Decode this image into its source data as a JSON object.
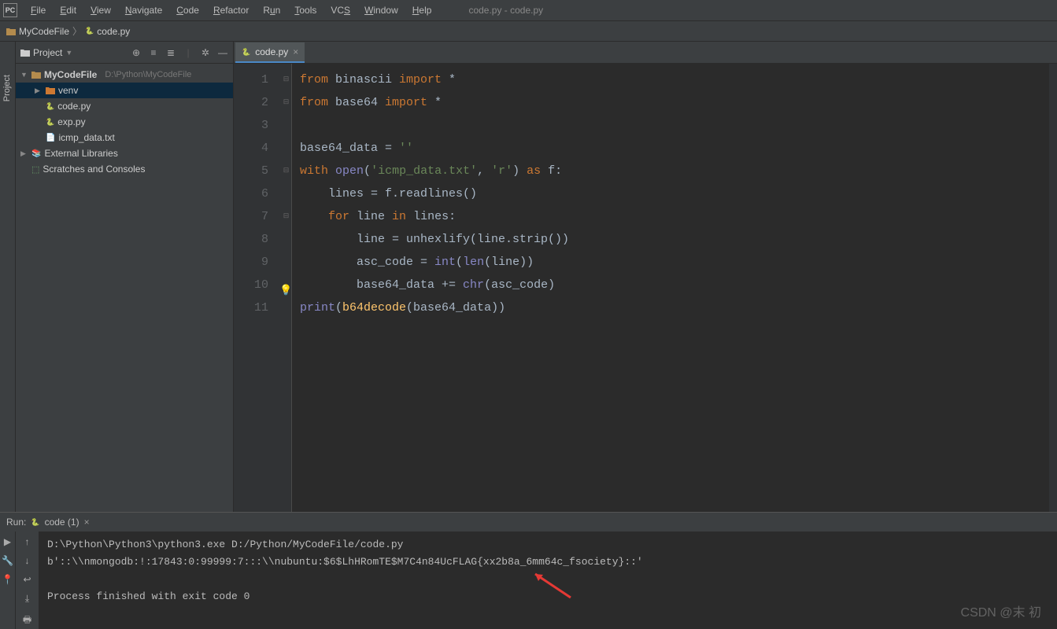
{
  "window_title": "code.py - code.py",
  "menu": [
    "File",
    "Edit",
    "View",
    "Navigate",
    "Code",
    "Refactor",
    "Run",
    "Tools",
    "VCS",
    "Window",
    "Help"
  ],
  "breadcrumbs": {
    "root": "MyCodeFile",
    "file": "code.py"
  },
  "project": {
    "pane_label": "Project",
    "root": {
      "name": "MyCodeFile",
      "path": "D:\\Python\\MyCodeFile"
    },
    "items": [
      {
        "name": "venv",
        "type": "dir"
      },
      {
        "name": "code.py",
        "type": "py"
      },
      {
        "name": "exp.py",
        "type": "py"
      },
      {
        "name": "icmp_data.txt",
        "type": "txt"
      }
    ],
    "external": "External Libraries",
    "scratches": "Scratches and Consoles"
  },
  "tab": {
    "label": "code.py"
  },
  "code_lines": [
    "from binascii import *",
    "from base64 import *",
    "",
    "base64_data = ''",
    "with open('icmp_data.txt', 'r') as f:",
    "    lines = f.readlines()",
    "    for line in lines:",
    "        line = unhexlify(line.strip())",
    "        asc_code = int(len(line))",
    "        base64_data += chr(asc_code)",
    "print(b64decode(base64_data))"
  ],
  "run": {
    "label": "Run:",
    "target": "code (1)",
    "output": [
      "D:\\Python\\Python3\\python3.exe D:/Python/MyCodeFile/code.py",
      "b'::\\\\nmongodb:!:17843:0:99999:7:::\\\\nubuntu:$6$LhHRomTE$M7C4n84UcFLAG{xx2b8a_6mm64c_fsociety}::'",
      "",
      "Process finished with exit code 0"
    ]
  },
  "watermark": "CSDN @末 初"
}
